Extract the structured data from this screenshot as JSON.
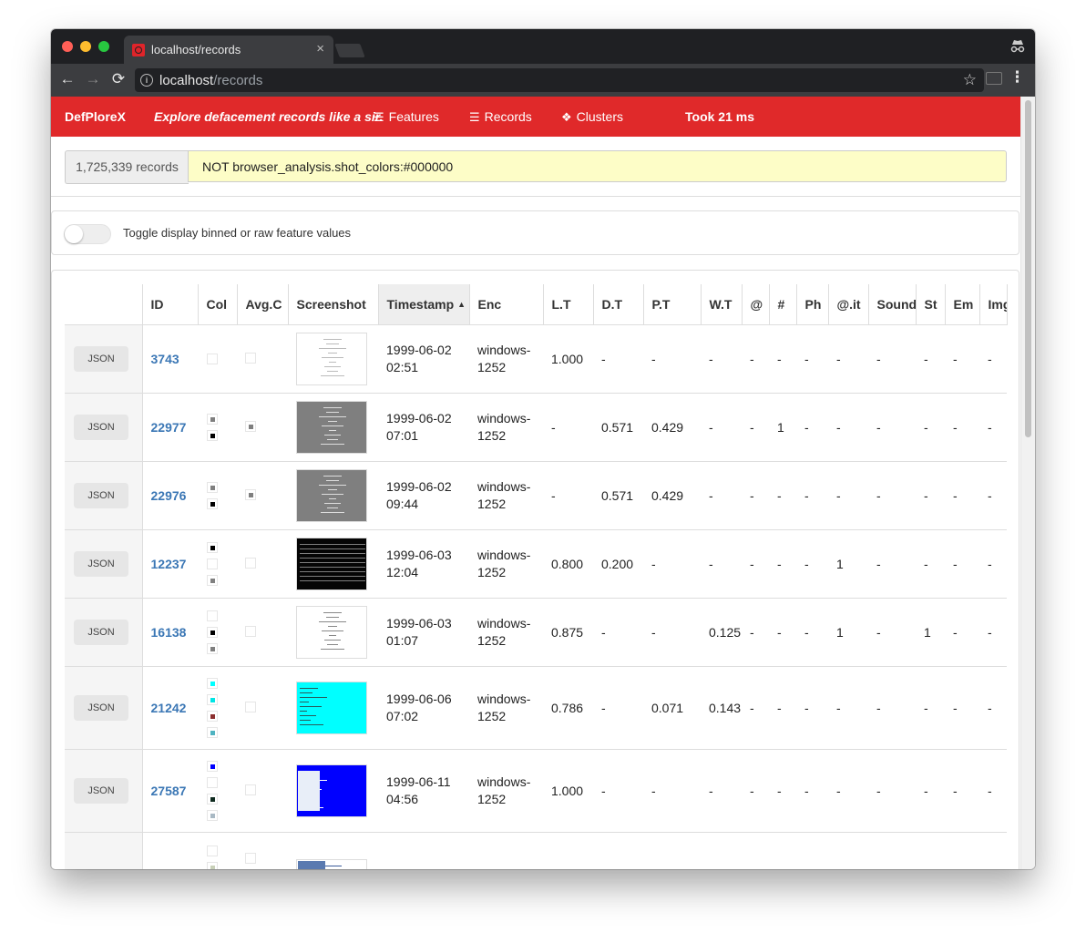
{
  "browser": {
    "tab_title": "localhost/records",
    "tab_close": "×",
    "url_host": "localhost",
    "url_path": "/records",
    "back": "←",
    "forward": "→",
    "reload": "⟳",
    "star": "☆",
    "menu": "⋮",
    "traffic_lights": [
      "#ff5f57",
      "#febc2e",
      "#28c840"
    ]
  },
  "nav": {
    "brand": "DefPloreX",
    "tagline": "Explore defacement records like a sir.",
    "features": "Features",
    "records": "Records",
    "clusters": "Clusters",
    "took": "Took 21 ms",
    "color": "#e0292a"
  },
  "search": {
    "count": "1,725,339 records",
    "query": "NOT browser_analysis.shot_colors:#000000"
  },
  "toggle": {
    "label": "Toggle display binned or raw feature values",
    "on": false
  },
  "table": {
    "headers": [
      "ID",
      "Col",
      "Avg.C",
      "Screenshot",
      "Timestamp",
      "Enc",
      "L.T",
      "D.T",
      "P.T",
      "W.T",
      "@",
      "#",
      "Ph",
      "@.it",
      "Sound",
      "St",
      "Em",
      "Img"
    ],
    "sorted_column": "Timestamp",
    "json_label": "JSON",
    "rows": [
      {
        "id": "3743",
        "colors": [
          "#ffffff"
        ],
        "avg": "#ffffff",
        "shot": "white",
        "date": "1999-06-02",
        "time": "02:51",
        "enc1": "windows-",
        "enc2": "1252",
        "lt": "1.000",
        "dt": "-",
        "pt": "-",
        "wt": "-",
        "at": "-",
        "hash": "-",
        "ph": "-",
        "atit": "-",
        "sound": "-",
        "st": "-",
        "em": "-",
        "img": "-"
      },
      {
        "id": "22977",
        "colors": [
          "#7f7f7f",
          "#000000"
        ],
        "avg": "#7f7f7f",
        "shot": "gray",
        "date": "1999-06-02",
        "time": "07:01",
        "enc1": "windows-",
        "enc2": "1252",
        "lt": "-",
        "dt": "0.571",
        "pt": "0.429",
        "wt": "-",
        "at": "-",
        "hash": "1",
        "ph": "-",
        "atit": "-",
        "sound": "-",
        "st": "-",
        "em": "-",
        "img": "-"
      },
      {
        "id": "22976",
        "colors": [
          "#7f7f7f",
          "#000000"
        ],
        "avg": "#7f7f7f",
        "shot": "gray",
        "date": "1999-06-02",
        "time": "09:44",
        "enc1": "windows-",
        "enc2": "1252",
        "lt": "-",
        "dt": "0.571",
        "pt": "0.429",
        "wt": "-",
        "at": "-",
        "hash": "-",
        "ph": "-",
        "atit": "-",
        "sound": "-",
        "st": "-",
        "em": "-",
        "img": "-"
      },
      {
        "id": "12237",
        "colors": [
          "#000000",
          "#ffffff",
          "#808080"
        ],
        "avg": "#ffffff",
        "shot": "black",
        "date": "1999-06-03",
        "time": "12:04",
        "enc1": "windows-",
        "enc2": "1252",
        "lt": "0.800",
        "dt": "0.200",
        "pt": "-",
        "wt": "-",
        "at": "-",
        "hash": "-",
        "ph": "-",
        "atit": "1",
        "sound": "-",
        "st": "-",
        "em": "-",
        "img": "-"
      },
      {
        "id": "16138",
        "colors": [
          "#ffffff",
          "#000000",
          "#7f7f7f"
        ],
        "avg": "#ffffff",
        "shot": "whitetext",
        "date": "1999-06-03",
        "time": "01:07",
        "enc1": "windows-",
        "enc2": "1252",
        "lt": "0.875",
        "dt": "-",
        "pt": "-",
        "wt": "0.125",
        "at": "-",
        "hash": "-",
        "ph": "-",
        "atit": "1",
        "sound": "-",
        "st": "1",
        "em": "-",
        "img": "-"
      },
      {
        "id": "21242",
        "colors": [
          "#00ffff",
          "#00e5e5",
          "#8b2e2e",
          "#4fb3c1"
        ],
        "avg": "#ffffff",
        "shot": "cyan",
        "date": "1999-06-06",
        "time": "07:02",
        "enc1": "windows-",
        "enc2": "1252",
        "lt": "0.786",
        "dt": "-",
        "pt": "0.071",
        "wt": "0.143",
        "at": "-",
        "hash": "-",
        "ph": "-",
        "atit": "-",
        "sound": "-",
        "st": "-",
        "em": "-",
        "img": "-"
      },
      {
        "id": "27587",
        "colors": [
          "#0000ff",
          "#ffffff",
          "#0f2b1f",
          "#a9b9c4"
        ],
        "avg": "#ffffff",
        "shot": "blue",
        "date": "1999-06-11",
        "time": "04:56",
        "enc1": "windows-",
        "enc2": "1252",
        "lt": "1.000",
        "dt": "-",
        "pt": "-",
        "wt": "-",
        "at": "-",
        "hash": "-",
        "ph": "-",
        "atit": "-",
        "sound": "-",
        "st": "-",
        "em": "-",
        "img": "-"
      },
      {
        "id": "",
        "colors": [
          "#ffffff",
          "#c8d0b8"
        ],
        "avg": "#ffffff",
        "shot": "partial",
        "date": "",
        "time": "",
        "enc1": "",
        "enc2": "",
        "lt": "",
        "dt": "",
        "pt": "",
        "wt": "",
        "at": "",
        "hash": "",
        "ph": "",
        "atit": "",
        "sound": "",
        "st": "",
        "em": "",
        "img": ""
      }
    ]
  }
}
